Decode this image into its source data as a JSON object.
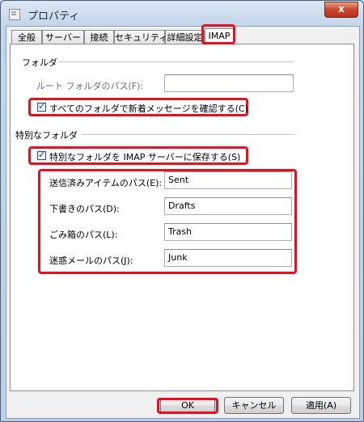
{
  "window": {
    "title": "プロパティ",
    "close_glyph": "x"
  },
  "tabs": [
    {
      "label": "全般"
    },
    {
      "label": "サーバー"
    },
    {
      "label": "接続"
    },
    {
      "label": "セキュリティ"
    },
    {
      "label": "詳細設定"
    },
    {
      "label": "IMAP",
      "active": true
    }
  ],
  "folders": {
    "group_label": "フォルダ",
    "root_path_label": "ルート フォルダのパス(F):",
    "root_path_value": "",
    "check_new_label": "すべてのフォルダで新着メッセージを確認する(C)",
    "check_new_checked": true
  },
  "special": {
    "group_label": "特別なフォルダ",
    "store_label": "特別なフォルダを IMAP サーバーに保存する(S)",
    "store_checked": true,
    "sent_label": "送信済みアイテムのパス(E):",
    "sent_value": "Sent",
    "drafts_label": "下書きのパス(D):",
    "drafts_value": "Drafts",
    "trash_label": "ごみ箱のパス(L):",
    "trash_value": "Trash",
    "junk_label": "迷惑メールのパス(J):",
    "junk_value": "Junk"
  },
  "buttons": {
    "ok": "OK",
    "cancel": "キャンセル",
    "apply": "適用(A)"
  },
  "colors": {
    "highlight": "#e8101e",
    "window_frame": "#c4d6ec"
  }
}
